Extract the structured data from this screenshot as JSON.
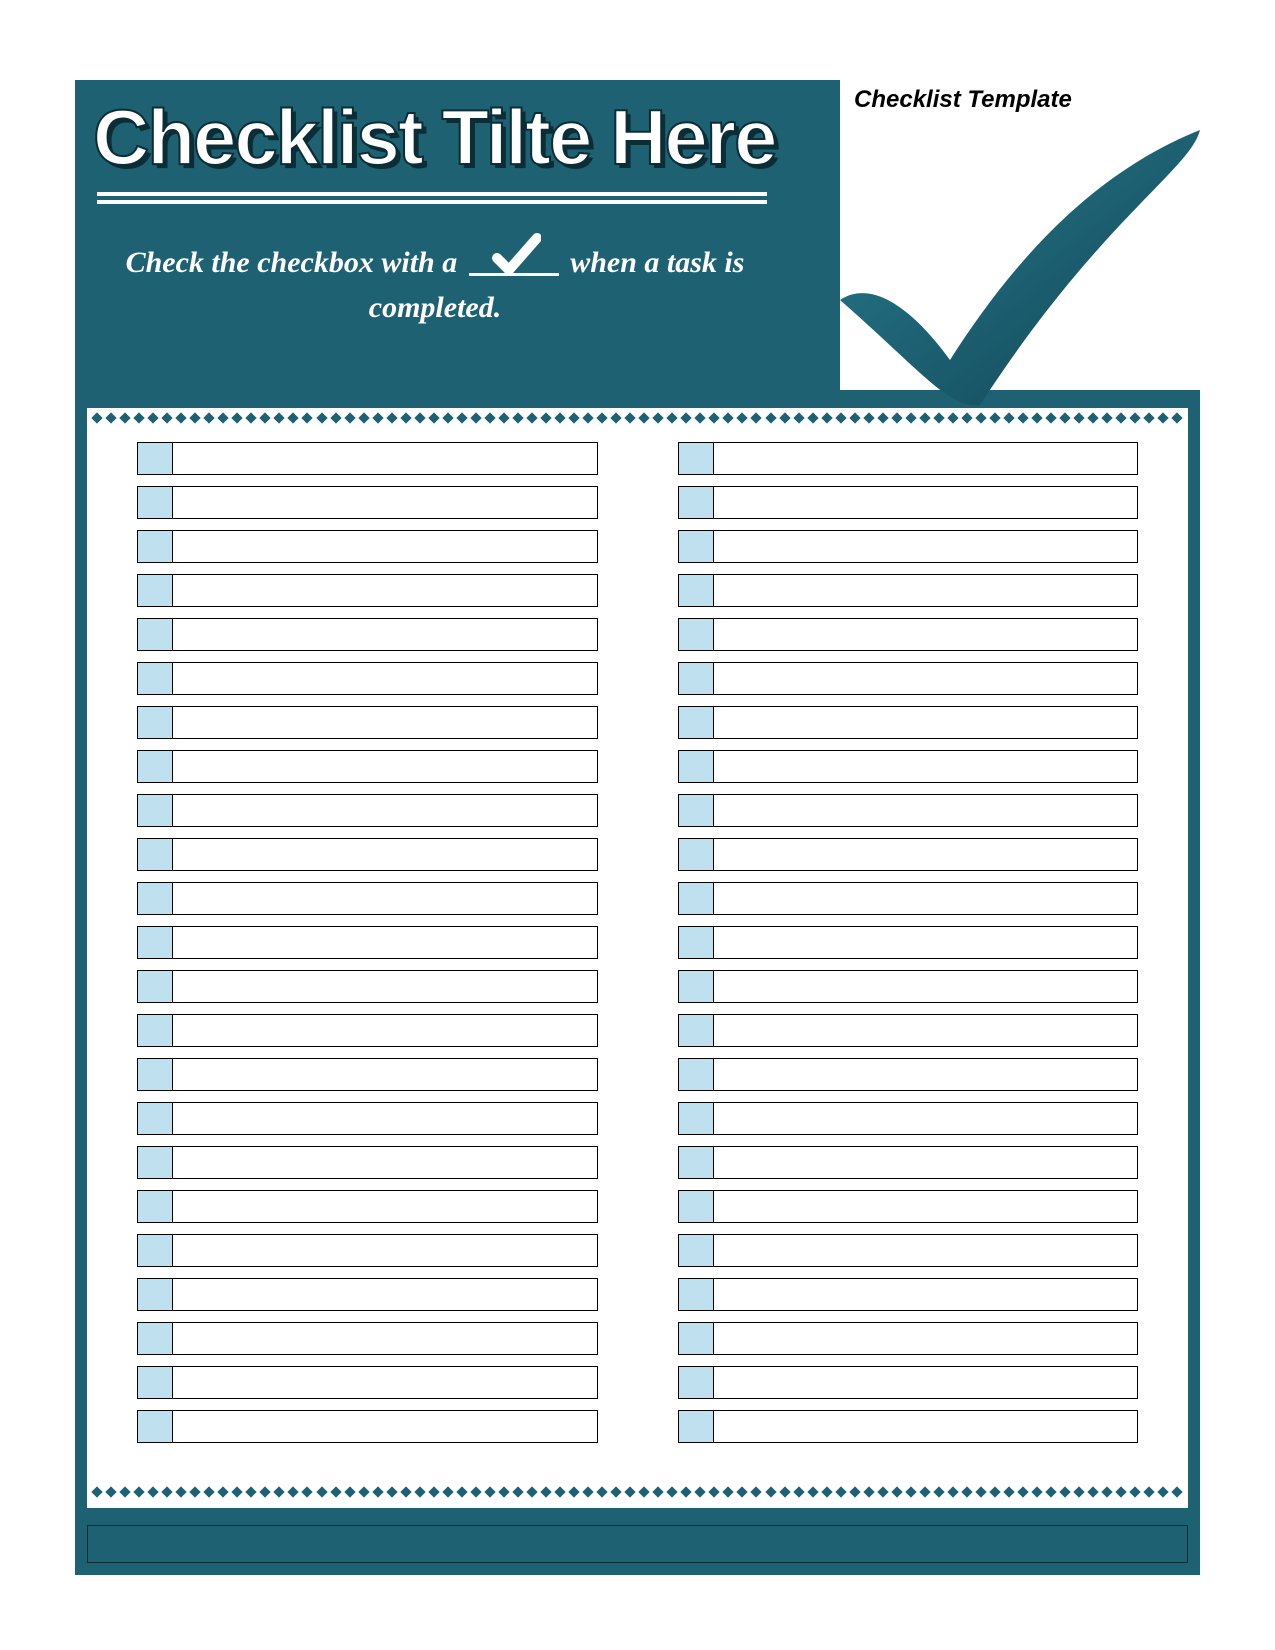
{
  "header": {
    "title": "Checklist Tilte Here",
    "instruction_before": "Check the checkbox with a",
    "instruction_after": "when a task is completed.",
    "logo_label": "Checklist Template"
  },
  "colors": {
    "brand": "#1e6173",
    "checkbox_fill": "#bfe1ef",
    "text_light": "#ffffff"
  },
  "checklist": {
    "rows_per_column": 23,
    "columns": 2,
    "left_items": [
      "",
      "",
      "",
      "",
      "",
      "",
      "",
      "",
      "",
      "",
      "",
      "",
      "",
      "",
      "",
      "",
      "",
      "",
      "",
      "",
      "",
      "",
      ""
    ],
    "right_items": [
      "",
      "",
      "",
      "",
      "",
      "",
      "",
      "",
      "",
      "",
      "",
      "",
      "",
      "",
      "",
      "",
      "",
      "",
      "",
      "",
      "",
      "",
      ""
    ]
  }
}
